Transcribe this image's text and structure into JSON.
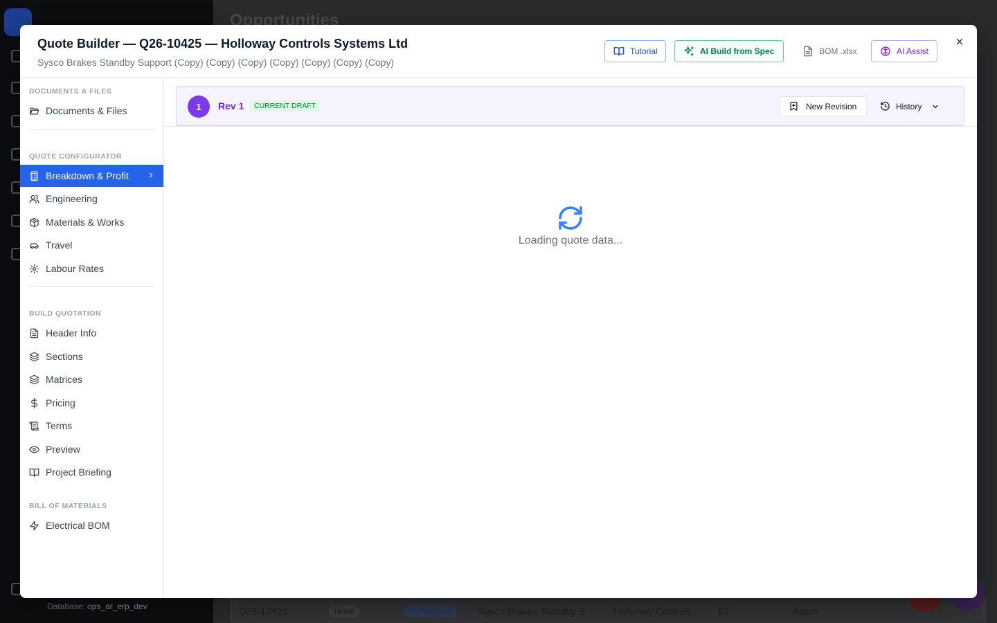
{
  "background": {
    "page_title": "Opportunities",
    "database_label": "Database:",
    "database_name": "ops_ar_erp_dev",
    "row": {
      "quote_no": "Q26-10423",
      "pill_a": "None",
      "status": "In Progress",
      "project": "Sysco Brakes Standby S...",
      "customer": "Holloway Controls...",
      "value": "£0",
      "owner": "Adam ..."
    }
  },
  "modal": {
    "title": "Quote Builder — Q26-10425 — Holloway Controls Systems Ltd",
    "subtitle": "Sysco Brakes Standby Support (Copy) (Copy) (Copy) (Copy) (Copy) (Copy) (Copy)",
    "buttons": {
      "tutorial": "Tutorial",
      "ai_build": "AI Build from Spec",
      "bom": "BOM .xlsx",
      "ai_assist": "AI Assist"
    },
    "close": "×"
  },
  "sidebar": {
    "sections": [
      {
        "label": "DOCUMENTS & FILES",
        "items": [
          "Documents & Files"
        ]
      },
      {
        "label": "QUOTE CONFIGURATOR",
        "items": [
          "Breakdown & Profit",
          "Engineering",
          "Materials & Works",
          "Travel",
          "Labour Rates"
        ]
      },
      {
        "label": "BUILD QUOTATION",
        "items": [
          "Header Info",
          "Sections",
          "Matrices",
          "Pricing",
          "Terms",
          "Preview",
          "Project Briefing"
        ]
      },
      {
        "label": "BILL OF MATERIALS",
        "items": [
          "Electrical BOM"
        ]
      }
    ],
    "active_item": "Breakdown & Profit"
  },
  "revision": {
    "number": "1",
    "label": "Rev 1",
    "badge": "CURRENT DRAFT",
    "new_revision": "New Revision",
    "history": "History"
  },
  "loading_text": "Loading quote data...",
  "colors": {
    "accent": "#2563eb",
    "revision_purple": "#7c3aed",
    "draft_green": "#15803d"
  }
}
